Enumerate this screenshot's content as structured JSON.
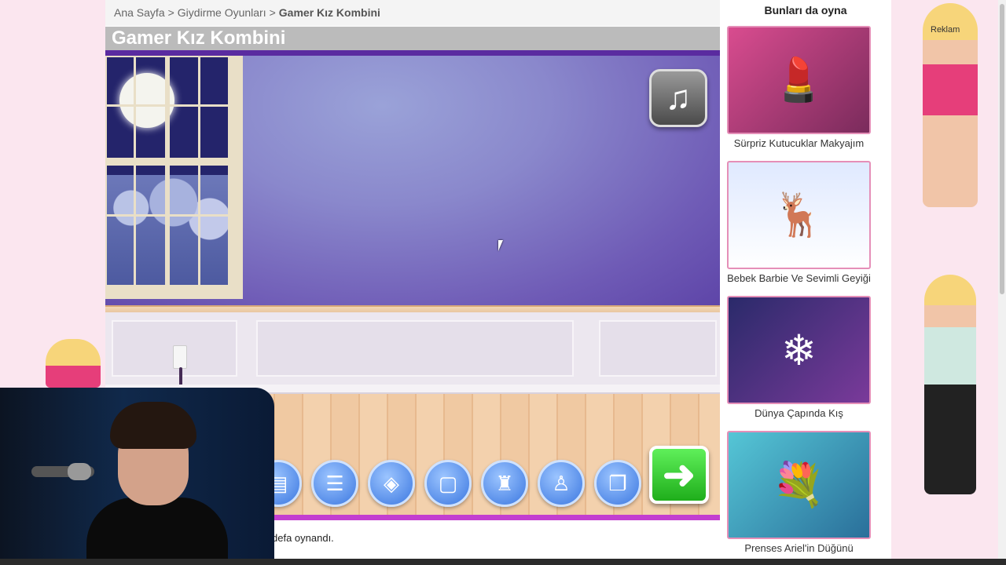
{
  "breadcrumb": {
    "home": "Ana Sayfa",
    "separator": ">",
    "category": "Giydirme Oyunları",
    "current": "Gamer Kız Kombini"
  },
  "page_title": "Gamer Kız Kombini",
  "game": {
    "music_icon": "music-note-icon",
    "tools": [
      "desk-icon",
      "cabinet-icon",
      "rug-icon",
      "frame-icon",
      "chair-icon",
      "lamp-icon",
      "poster-icon"
    ],
    "next_icon": "arrow-right-icon"
  },
  "play_count_text": "defa oynandı.",
  "sidebar": {
    "heading": "Bunları da oyna",
    "cards": [
      {
        "title": "Sürpriz Kutucuklar Makyajım",
        "color": "#c13a7a",
        "glyph": "💄"
      },
      {
        "title": "Bebek Barbie Ve Sevimli Geyiği",
        "color": "#e9f1ff",
        "glyph": "🦌"
      },
      {
        "title": "Dünya Çapında Kış",
        "color": "#2a2a6a",
        "glyph": "❄"
      },
      {
        "title": "Prenses Ariel'in Düğünü",
        "color": "#3bb3c8",
        "glyph": "💐"
      }
    ]
  },
  "ad": {
    "label": "Reklam"
  },
  "colors": {
    "accent": "#e58fb8",
    "page_bg": "#fbe6ef",
    "game_strip": "#c33ed0"
  }
}
